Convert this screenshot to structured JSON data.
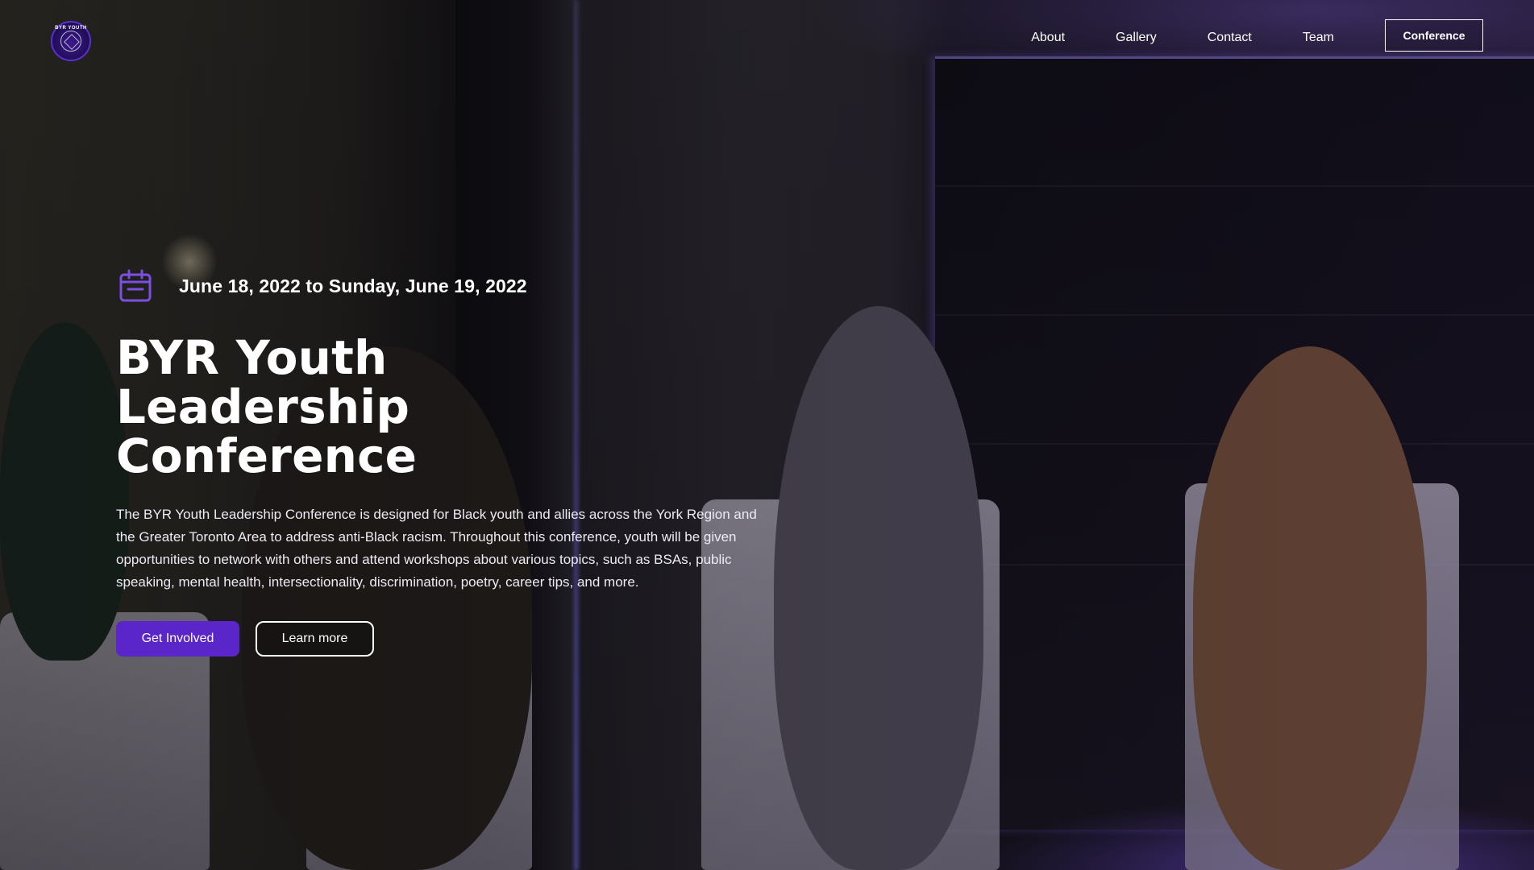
{
  "nav": {
    "logo_text": "BYR YOUTH",
    "links": [
      "About",
      "Gallery",
      "Contact",
      "Team"
    ],
    "cta_label": "Conference"
  },
  "hero": {
    "date": "June 18, 2022 to Sunday, June 19, 2022",
    "title": "BYR Youth Leadership Conference",
    "description": "The BYR Youth Leadership Conference is designed for Black youth and allies across the York Region and the Greater Toronto Area to address anti-Black racism. Throughout this conference, youth will be given opportunities to network with others and attend workshops about various topics, such as BSAs, public speaking, mental health, intersectionality, discrimination, poetry, career tips, and more.",
    "primary_button": "Get Involved",
    "secondary_button": "Learn more"
  },
  "icons": {
    "calendar": "calendar-icon",
    "logo": "logo-icon"
  },
  "colors": {
    "accent": "#5a26c9",
    "icon_purple": "#7b4fe0",
    "text": "#ffffff"
  }
}
